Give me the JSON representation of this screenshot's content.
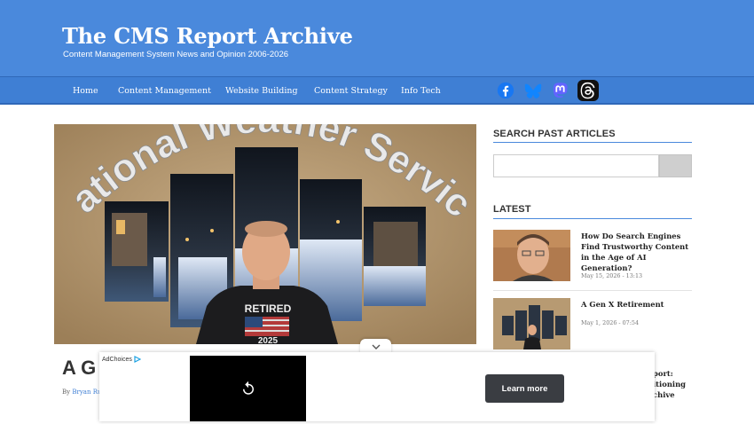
{
  "site": {
    "title": "The CMS Report Archive",
    "tagline": "Content Management System News and Opinion 2006-2026"
  },
  "nav": {
    "items": [
      "Home",
      "Content Management",
      "Website Building",
      "Content Strategy",
      "Info Tech"
    ],
    "social": [
      "facebook-icon",
      "bluesky-icon",
      "mastodon-icon",
      "threads-icon"
    ]
  },
  "hero": {
    "wall_text": "National Weather Service",
    "shirt_text": "RETIRED",
    "shirt_year": "2025"
  },
  "article": {
    "title_visible": "A G",
    "byline_prefix": "By",
    "author_visible": "Bryan Ru"
  },
  "sidebar": {
    "search_heading": "SEARCH PAST ARTICLES",
    "search_placeholder": "",
    "latest_heading": "LATEST",
    "latest": [
      {
        "title": "How Do Search Engines Find Trustworthy Content in the Age of AI Generation?",
        "date": "May 15, 2026 - 13:13"
      },
      {
        "title": "A Gen X Retirement",
        "date": "May 1, 2026 - 07:54"
      }
    ],
    "partial_third_title": [
      "port:",
      "itioning",
      "chive"
    ]
  },
  "ad": {
    "adchoices_label": "AdChoices",
    "learn_more": "Learn more"
  },
  "colors": {
    "header_blue": "#4a89dc",
    "nav_blue": "#3f7fd4",
    "rule_blue": "#4a89dc"
  }
}
